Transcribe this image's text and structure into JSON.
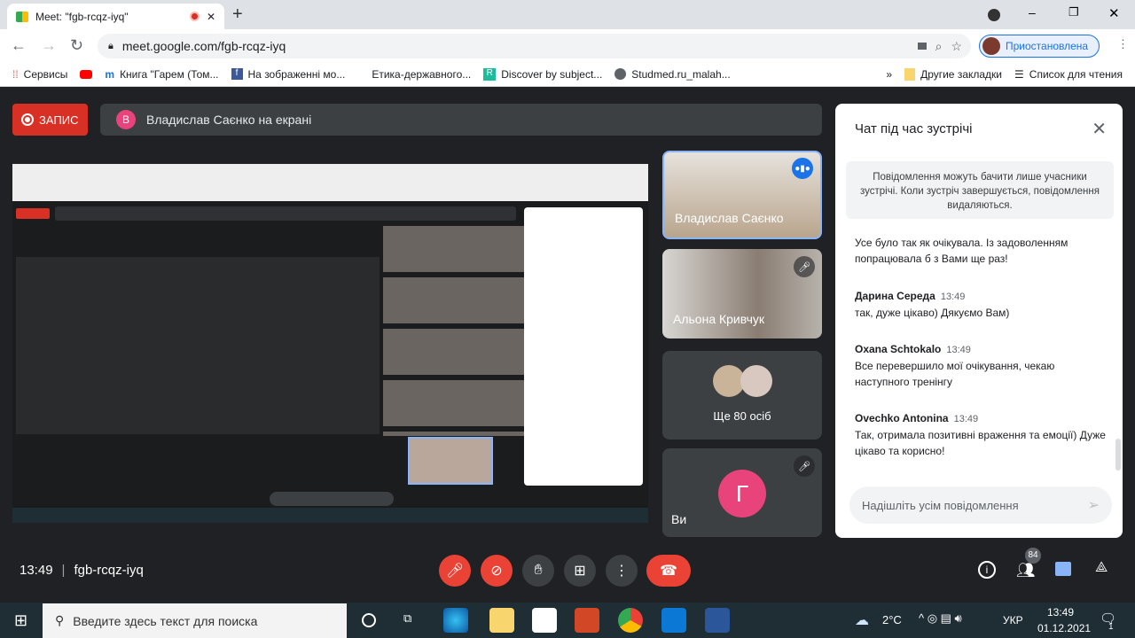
{
  "browser": {
    "tab_title": "Meet: \"fgb-rcqz-iyq\"",
    "url": "meet.google.com/fgb-rcqz-iyq",
    "profile_label": "Приостановлена",
    "bookmarks": [
      "Сервисы",
      "Книга \"Гарем (Том...",
      "На зображенні мо...",
      "Етика-державного...",
      "Discover by subject...",
      "Studmed.ru_malah..."
    ],
    "other_bookmarks": "Другие закладки",
    "reading_list": "Список для чтения"
  },
  "meet": {
    "record_label": "ЗАПИС",
    "presenter_initial": "В",
    "presenting_text": "Владислав Саєнко на екрані",
    "tiles": [
      {
        "name": "Владислав Саєнко",
        "state": "speaking"
      },
      {
        "name": "Альона Кривчук",
        "state": "muted"
      },
      {
        "more_label": "Ще 80 осіб"
      },
      {
        "name": "Ви",
        "initial": "Г",
        "state": "muted"
      }
    ],
    "time": "13:49",
    "meeting_code": "fgb-rcqz-iyq",
    "participants_count": "84",
    "colors": {
      "red": "#d93025",
      "blue": "#1a73e8",
      "avatar_pink": "#e8437a"
    }
  },
  "chat": {
    "title": "Чат під час зустрічі",
    "notice": "Повідомлення можуть бачити лише учасники зустрічі. Коли зустріч завершується, повідомлення видаляються.",
    "messages": [
      {
        "author": "",
        "time": "",
        "text": "Усе було так як очікувала. Із задоволенням попрацювала б з Вами ще раз!"
      },
      {
        "author": "Дарина Середа",
        "time": "13:49",
        "text": "так, дуже цікаво) Дякуємо Вам)"
      },
      {
        "author": "Oxana Schtokalo",
        "time": "13:49",
        "text": "Все перевершило мої очікування, чекаю наступного тренінгу"
      },
      {
        "author": "Ovechko Antonina",
        "time": "13:49",
        "text": "Так, отримала позитивні враження та емоції) Дуже цікаво та корисно!"
      }
    ],
    "input_placeholder": "Надішліть усім повідомлення"
  },
  "taskbar": {
    "search_placeholder": "Введите здесь текст для поиска",
    "weather": "2°C",
    "language": "УКР",
    "time": "13:49",
    "date": "01.12.2021",
    "notifications": "1"
  }
}
